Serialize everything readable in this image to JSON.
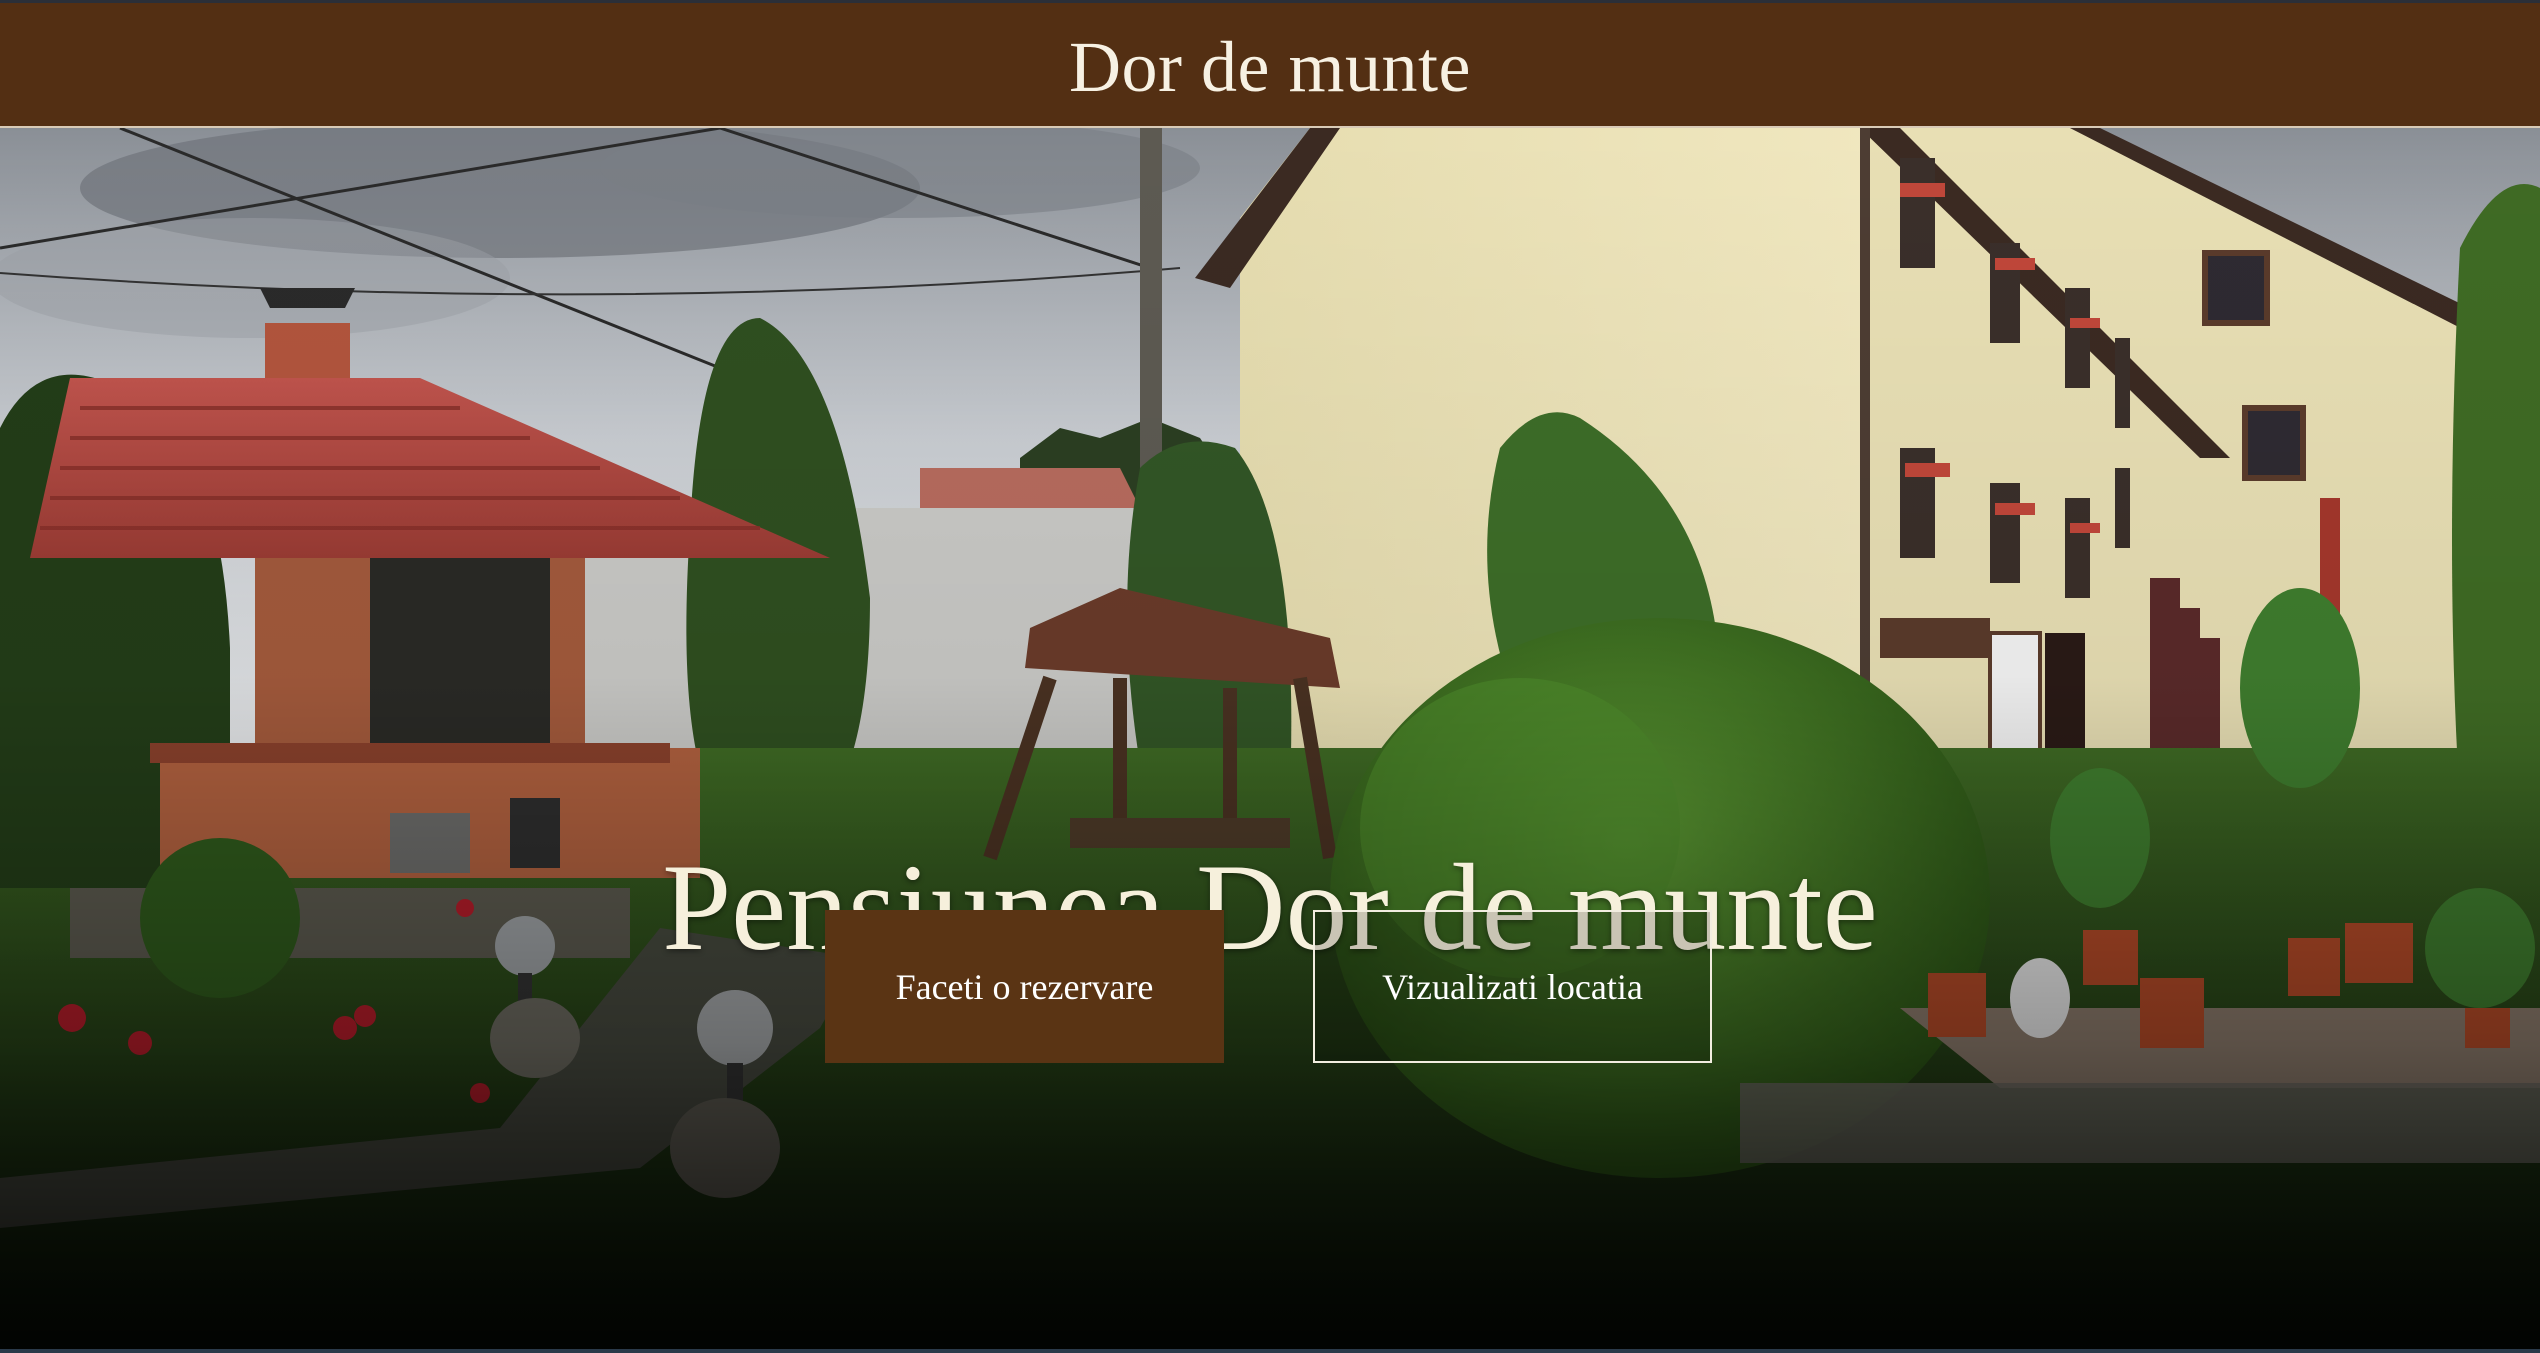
{
  "header": {
    "site_title": "Dor de munte"
  },
  "hero": {
    "heading": "Pensiunea Dor de munte",
    "background_image": "guesthouse-garden-photo"
  },
  "cta": {
    "primary_label": "Faceti o rezervare",
    "secondary_label": "Vizualizati locatia"
  },
  "colors": {
    "header_bg": "#532f13",
    "primary_button_bg": "#5a3414",
    "heading_text": "#f6f0dc"
  }
}
